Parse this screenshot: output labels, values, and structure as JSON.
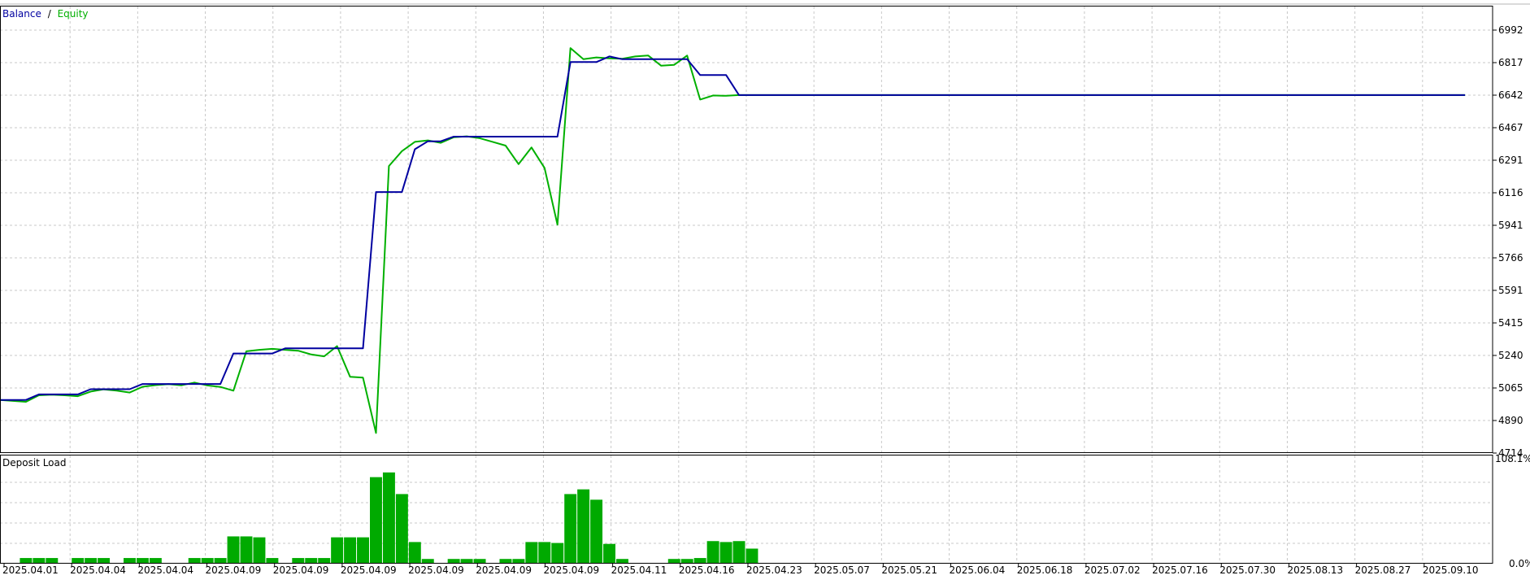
{
  "legend": {
    "balance_label": "Balance",
    "separator": "/",
    "equity_label": "Equity"
  },
  "lower_panel": {
    "title": "Deposit Load"
  },
  "colors": {
    "balance": "#0000a0",
    "equity": "#00b000",
    "bars": "#00aa00",
    "grid": "#c8c8c8",
    "frame": "#000000",
    "background": "#ffffff"
  },
  "chart_data": [
    {
      "type": "line",
      "title": "",
      "ylim": [
        4714,
        7078
      ],
      "y_ticks": [
        "6992",
        "6817",
        "6642",
        "6467",
        "6291",
        "6116",
        "5941",
        "5766",
        "5591",
        "5415",
        "5240",
        "5065",
        "4890",
        "4714"
      ],
      "x_ticks": [
        "2025.04.01",
        "2025.04.04",
        "2025.04.04",
        "2025.04.09",
        "2025.04.09",
        "2025.04.09",
        "2025.04.09",
        "2025.04.09",
        "2025.04.09",
        "2025.04.11",
        "2025.04.16",
        "2025.04.23",
        "2025.05.07",
        "2025.05.21",
        "2025.06.04",
        "2025.06.18",
        "2025.07.02",
        "2025.07.16",
        "2025.07.30",
        "2025.08.13",
        "2025.08.27",
        "2025.09.10"
      ],
      "x_range": [
        0,
        114
      ],
      "grid": true,
      "series": [
        {
          "name": "Balance",
          "points": [
            [
              0,
              5000
            ],
            [
              2,
              5000
            ],
            [
              3,
              5030
            ],
            [
              6,
              5030
            ],
            [
              7,
              5058
            ],
            [
              10,
              5058
            ],
            [
              11,
              5086
            ],
            [
              17,
              5086
            ],
            [
              18,
              5250
            ],
            [
              21,
              5250
            ],
            [
              22,
              5278
            ],
            [
              28,
              5278
            ],
            [
              29,
              6120
            ],
            [
              31,
              6120
            ],
            [
              32,
              6350
            ],
            [
              33,
              6393
            ],
            [
              34,
              6393
            ],
            [
              35,
              6418
            ],
            [
              43,
              6418
            ],
            [
              44,
              6820
            ],
            [
              46,
              6820
            ],
            [
              47,
              6850
            ],
            [
              48,
              6835
            ],
            [
              53,
              6835
            ],
            [
              54,
              6750
            ],
            [
              56,
              6750
            ],
            [
              57,
              6642
            ],
            [
              113,
              6642
            ]
          ]
        },
        {
          "name": "Equity",
          "points": [
            [
              0,
              5000
            ],
            [
              1,
              4995
            ],
            [
              2,
              4990
            ],
            [
              3,
              5025
            ],
            [
              4,
              5028
            ],
            [
              5,
              5025
            ],
            [
              6,
              5020
            ],
            [
              7,
              5045
            ],
            [
              8,
              5057
            ],
            [
              9,
              5050
            ],
            [
              10,
              5040
            ],
            [
              11,
              5071
            ],
            [
              12,
              5080
            ],
            [
              13,
              5085
            ],
            [
              14,
              5079
            ],
            [
              15,
              5094
            ],
            [
              16,
              5078
            ],
            [
              17,
              5070
            ],
            [
              18,
              5050
            ],
            [
              19,
              5262
            ],
            [
              20,
              5270
            ],
            [
              21,
              5275
            ],
            [
              22,
              5270
            ],
            [
              23,
              5265
            ],
            [
              24,
              5245
            ],
            [
              25,
              5235
            ],
            [
              26,
              5290
            ],
            [
              27,
              5125
            ],
            [
              28,
              5120
            ],
            [
              29,
              4822
            ],
            [
              30,
              6260
            ],
            [
              31,
              6340
            ],
            [
              32,
              6390
            ],
            [
              33,
              6398
            ],
            [
              34,
              6385
            ],
            [
              35,
              6415
            ],
            [
              36,
              6420
            ],
            [
              37,
              6410
            ],
            [
              38,
              6390
            ],
            [
              39,
              6370
            ],
            [
              40,
              6270
            ],
            [
              41,
              6360
            ],
            [
              42,
              6250
            ],
            [
              43,
              5944
            ],
            [
              44,
              6895
            ],
            [
              45,
              6835
            ],
            [
              46,
              6845
            ],
            [
              47,
              6840
            ],
            [
              48,
              6838
            ],
            [
              49,
              6850
            ],
            [
              50,
              6855
            ],
            [
              51,
              6800
            ],
            [
              52,
              6805
            ],
            [
              53,
              6855
            ],
            [
              54,
              6618
            ],
            [
              55,
              6640
            ],
            [
              56,
              6638
            ],
            [
              57,
              6642
            ],
            [
              113,
              6642
            ]
          ]
        }
      ]
    },
    {
      "type": "bar",
      "title": "Deposit Load",
      "ylim": [
        0,
        108.1
      ],
      "y_ticks": [
        "108.1%",
        "0.0%"
      ],
      "grid": true,
      "bars": [
        {
          "x": 2,
          "value": 6
        },
        {
          "x": 3,
          "value": 6
        },
        {
          "x": 4,
          "value": 6
        },
        {
          "x": 6,
          "value": 6
        },
        {
          "x": 7,
          "value": 6
        },
        {
          "x": 8,
          "value": 6
        },
        {
          "x": 10,
          "value": 6
        },
        {
          "x": 11,
          "value": 6
        },
        {
          "x": 12,
          "value": 6
        },
        {
          "x": 15,
          "value": 6
        },
        {
          "x": 16,
          "value": 6
        },
        {
          "x": 17,
          "value": 6
        },
        {
          "x": 18,
          "value": 29
        },
        {
          "x": 19,
          "value": 29
        },
        {
          "x": 20,
          "value": 28
        },
        {
          "x": 21,
          "value": 6
        },
        {
          "x": 23,
          "value": 6
        },
        {
          "x": 24,
          "value": 6
        },
        {
          "x": 25,
          "value": 6
        },
        {
          "x": 26,
          "value": 28
        },
        {
          "x": 27,
          "value": 28
        },
        {
          "x": 28,
          "value": 28
        },
        {
          "x": 29,
          "value": 92
        },
        {
          "x": 30,
          "value": 97
        },
        {
          "x": 31,
          "value": 74
        },
        {
          "x": 32,
          "value": 23
        },
        {
          "x": 33,
          "value": 5
        },
        {
          "x": 35,
          "value": 5
        },
        {
          "x": 36,
          "value": 5
        },
        {
          "x": 37,
          "value": 5
        },
        {
          "x": 39,
          "value": 5
        },
        {
          "x": 40,
          "value": 5
        },
        {
          "x": 41,
          "value": 23
        },
        {
          "x": 42,
          "value": 23
        },
        {
          "x": 43,
          "value": 22
        },
        {
          "x": 44,
          "value": 74
        },
        {
          "x": 45,
          "value": 79
        },
        {
          "x": 46,
          "value": 68
        },
        {
          "x": 47,
          "value": 21
        },
        {
          "x": 48,
          "value": 5
        },
        {
          "x": 52,
          "value": 5
        },
        {
          "x": 53,
          "value": 5
        },
        {
          "x": 54,
          "value": 6
        },
        {
          "x": 55,
          "value": 24
        },
        {
          "x": 56,
          "value": 23
        },
        {
          "x": 57,
          "value": 24
        },
        {
          "x": 58,
          "value": 16
        }
      ]
    }
  ]
}
